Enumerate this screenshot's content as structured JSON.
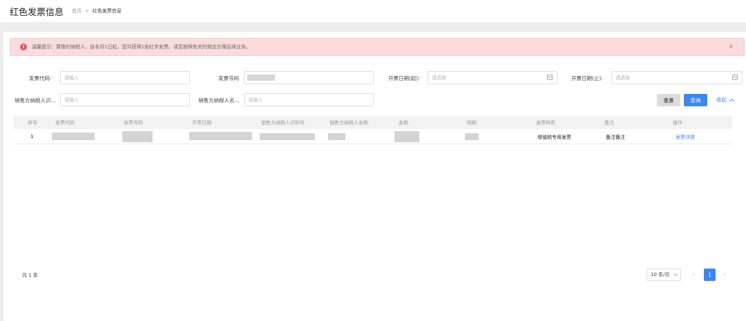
{
  "header": {
    "title": "红色发票信息",
    "breadcrumb": {
      "home": "首页",
      "separator": ">",
      "current": "红色发票信息"
    }
  },
  "alert": {
    "icon": "exclamation-circle-icon",
    "text": "温馨提示：尊敬的纳税人，自本月1日起，您共获得1张红字发票，请您按照有关的规定办理后续业务。",
    "close": "×",
    "color": "#fbdcdc"
  },
  "filters": {
    "invoice_code_label": "发票代码:",
    "invoice_code_placeholder": "请输入",
    "invoice_number_label": "发票号码",
    "invoice_date_start_label": "开票日期(起):",
    "invoice_date_start_placeholder": "请选择",
    "invoice_date_end_label": "开票日期(止):",
    "invoice_date_end_placeholder": "请选择",
    "seller_tax_id_label": "销售方纳税人识...",
    "seller_tax_id_placeholder": "请输入",
    "seller_name_label": "销售方纳税人名...",
    "seller_name_placeholder": "请输入"
  },
  "actions": {
    "reset": "重置",
    "query": "查询",
    "collapse": "收起",
    "accent": "#3d87f5"
  },
  "table": {
    "columns": [
      "序号",
      "发票代码",
      "发票号码",
      "开票日期",
      "销售方纳税人识别号",
      "销售方纳税人名称",
      "金额",
      "税额",
      "发票种类",
      "备注",
      "操作"
    ],
    "rows": [
      {
        "index": "1",
        "invoice_type": "增值税专用发票",
        "remark": "备注备注",
        "action": "发票详情"
      }
    ]
  },
  "pagination": {
    "total": "共 1 条",
    "page_size": "10 条/页",
    "prev": "‹",
    "current": "1",
    "next": "›"
  }
}
